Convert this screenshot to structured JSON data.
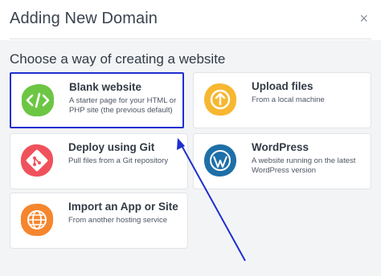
{
  "dialog": {
    "title": "Adding New Domain",
    "close_glyph": "×",
    "subtitle": "Choose a way of creating a website"
  },
  "options": [
    {
      "name": "Blank website",
      "desc": "A starter page for your HTML or PHP site (the previous default)",
      "icon": "code-icon",
      "color": "#6cc644"
    },
    {
      "name": "Upload files",
      "desc": "From a local machine",
      "icon": "upload-icon",
      "color": "#f7b731"
    },
    {
      "name": "Deploy using Git",
      "desc": "Pull files from a Git repository",
      "icon": "git-icon",
      "color": "#f0525d"
    },
    {
      "name": "WordPress",
      "desc": "A website running on the latest WordPress version",
      "icon": "wordpress-icon",
      "color": "#1e6fa8"
    },
    {
      "name": "Import an App or Site",
      "desc": "From another hosting service",
      "icon": "globe-icon",
      "color": "#f6862d"
    }
  ],
  "annotation": {
    "highlight_color": "#1f2fd0"
  }
}
